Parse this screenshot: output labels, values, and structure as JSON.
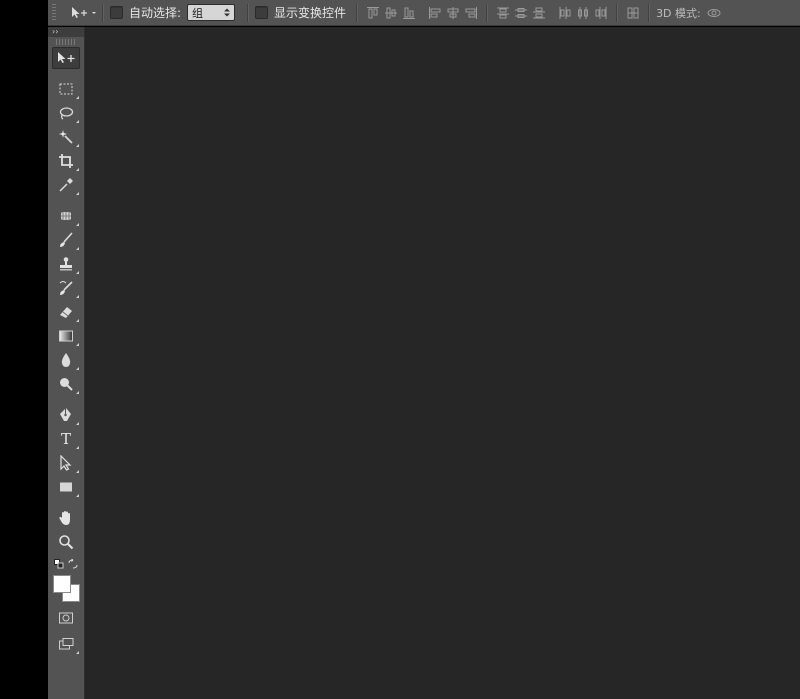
{
  "options_bar": {
    "auto_select_label": "自动选择:",
    "auto_select_value": "组",
    "show_transform_label": "显示变换控件",
    "mode_label": "3D 模式:"
  },
  "toolbox": {
    "collapse_label": "››",
    "tools": [
      {
        "name": "move-tool",
        "icon": "move-icon"
      },
      {
        "name": "marquee-tool",
        "icon": "rect-marquee-icon"
      },
      {
        "name": "lasso-tool",
        "icon": "lasso-icon"
      },
      {
        "name": "magic-wand-tool",
        "icon": "magic-wand-icon"
      },
      {
        "name": "crop-tool",
        "icon": "crop-icon"
      },
      {
        "name": "eyedropper-tool",
        "icon": "eyedropper-icon"
      },
      {
        "name": "healing-brush-tool",
        "icon": "healing-brush-icon"
      },
      {
        "name": "brush-tool",
        "icon": "brush-icon"
      },
      {
        "name": "clone-stamp-tool",
        "icon": "stamp-icon"
      },
      {
        "name": "history-brush-tool",
        "icon": "history-brush-icon"
      },
      {
        "name": "eraser-tool",
        "icon": "eraser-icon"
      },
      {
        "name": "gradient-tool",
        "icon": "gradient-icon"
      },
      {
        "name": "blur-tool",
        "icon": "drop-icon"
      },
      {
        "name": "dodge-tool",
        "icon": "dodge-icon"
      },
      {
        "name": "pen-tool",
        "icon": "pen-icon"
      },
      {
        "name": "type-tool",
        "icon": "type-icon",
        "glyph": "T"
      },
      {
        "name": "path-selection-tool",
        "icon": "path-select-icon"
      },
      {
        "name": "rectangle-tool",
        "icon": "rectangle-icon"
      },
      {
        "name": "hand-tool",
        "icon": "hand-icon"
      },
      {
        "name": "zoom-tool",
        "icon": "zoom-icon"
      }
    ],
    "foreground_color": "#ffffff",
    "background_color": "#ffffff"
  },
  "colors": {
    "panel": "#535353",
    "canvas": "#262626"
  }
}
